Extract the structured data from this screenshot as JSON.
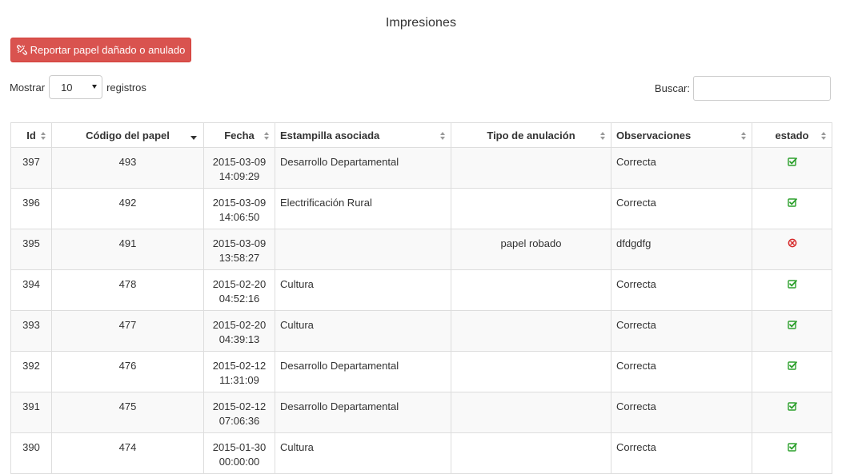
{
  "page": {
    "title": "Impresiones"
  },
  "report_button": {
    "label": "Reportar papel dañado o anulado",
    "icon": "unlink-icon",
    "color": "#d9534f"
  },
  "length_control": {
    "prefix": "Mostrar",
    "value": "10",
    "suffix": "registros"
  },
  "search": {
    "label": "Buscar:",
    "value": "",
    "placeholder": ""
  },
  "table": {
    "columns": [
      {
        "label": "Id",
        "sort": "both"
      },
      {
        "label": "Código del papel",
        "sort": "desc"
      },
      {
        "label": "Fecha",
        "sort": "both"
      },
      {
        "label": "Estampilla asociada",
        "sort": "both"
      },
      {
        "label": "Tipo de anulación",
        "sort": "both"
      },
      {
        "label": "Observaciones",
        "sort": "both"
      },
      {
        "label": "estado",
        "sort": "both"
      }
    ],
    "rows": [
      {
        "id": "397",
        "codigo": "493",
        "fecha_dia": "2015-03-09",
        "fecha_hora": "14:09:29",
        "estampilla": "Desarrollo Departamental",
        "tipo": "",
        "observaciones": "Correcta",
        "estado": "ok"
      },
      {
        "id": "396",
        "codigo": "492",
        "fecha_dia": "2015-03-09",
        "fecha_hora": "14:06:50",
        "estampilla": "Electrificación Rural",
        "tipo": "",
        "observaciones": "Correcta",
        "estado": "ok"
      },
      {
        "id": "395",
        "codigo": "491",
        "fecha_dia": "2015-03-09",
        "fecha_hora": "13:58:27",
        "estampilla": "",
        "tipo": "papel robado",
        "observaciones": "dfdgdfg",
        "estado": "anulado"
      },
      {
        "id": "394",
        "codigo": "478",
        "fecha_dia": "2015-02-20",
        "fecha_hora": "04:52:16",
        "estampilla": "Cultura",
        "tipo": "",
        "observaciones": "Correcta",
        "estado": "ok"
      },
      {
        "id": "393",
        "codigo": "477",
        "fecha_dia": "2015-02-20",
        "fecha_hora": "04:39:13",
        "estampilla": "Cultura",
        "tipo": "",
        "observaciones": "Correcta",
        "estado": "ok"
      },
      {
        "id": "392",
        "codigo": "476",
        "fecha_dia": "2015-02-12",
        "fecha_hora": "11:31:09",
        "estampilla": "Desarrollo Departamental",
        "tipo": "",
        "observaciones": "Correcta",
        "estado": "ok"
      },
      {
        "id": "391",
        "codigo": "475",
        "fecha_dia": "2015-02-12",
        "fecha_hora": "07:06:36",
        "estampilla": "Desarrollo Departamental",
        "tipo": "",
        "observaciones": "Correcta",
        "estado": "ok"
      },
      {
        "id": "390",
        "codigo": "474",
        "fecha_dia": "2015-01-30",
        "fecha_hora": "00:00:00",
        "estampilla": "Cultura",
        "tipo": "",
        "observaciones": "Correcta",
        "estado": "ok"
      }
    ]
  },
  "status_icons": {
    "ok": {
      "name": "check-square-icon",
      "color": "#2ca02c"
    },
    "anulado": {
      "name": "times-circle-icon",
      "color": "#d62728"
    }
  }
}
